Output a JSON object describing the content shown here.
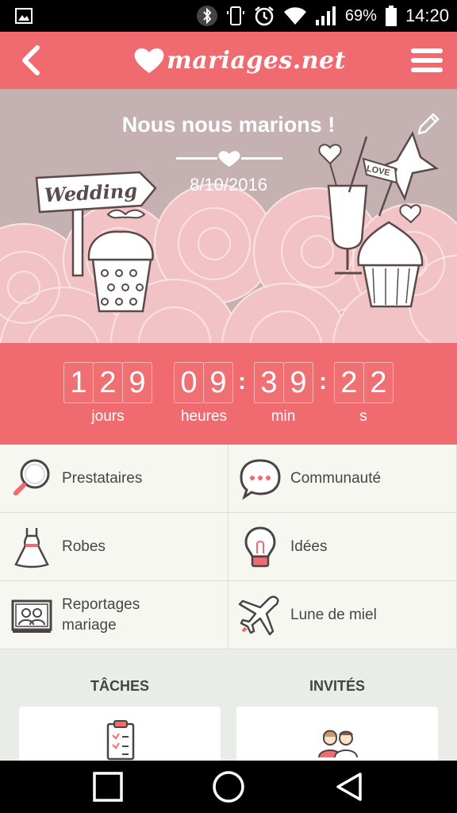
{
  "status_bar": {
    "battery": "69%",
    "time": "14:20"
  },
  "header": {
    "logo_text": "mariages.net"
  },
  "hero": {
    "title": "Nous nous marions !",
    "date": "8/10/2016",
    "sign_text": "Wedding",
    "flag_text": "LOVE"
  },
  "countdown": {
    "days": [
      "1",
      "2",
      "9"
    ],
    "hours": [
      "0",
      "9"
    ],
    "minutes": [
      "3",
      "9"
    ],
    "seconds": [
      "2",
      "2"
    ],
    "separator": ":",
    "labels": {
      "days": "jours",
      "hours": "heures",
      "minutes": "min",
      "seconds": "s"
    }
  },
  "menu": {
    "items": [
      {
        "label": "Prestataires",
        "icon": "magnifier-icon"
      },
      {
        "label": "Communauté",
        "icon": "speech-bubble-icon"
      },
      {
        "label": "Robes",
        "icon": "dress-icon"
      },
      {
        "label": "Idées",
        "icon": "lightbulb-icon"
      },
      {
        "label": "Reportages\nmariage",
        "icon": "photo-album-icon"
      },
      {
        "label": "Lune de miel",
        "icon": "airplane-icon"
      }
    ]
  },
  "sections": {
    "tasks_title": "TÂCHES",
    "guests_title": "INVITÉS"
  },
  "colors": {
    "accent": "#ef6b6f",
    "hero_bg": "#c6b1b2",
    "pink": "#f2c3c6",
    "text": "#4a4443",
    "background": "#e9ece7"
  }
}
